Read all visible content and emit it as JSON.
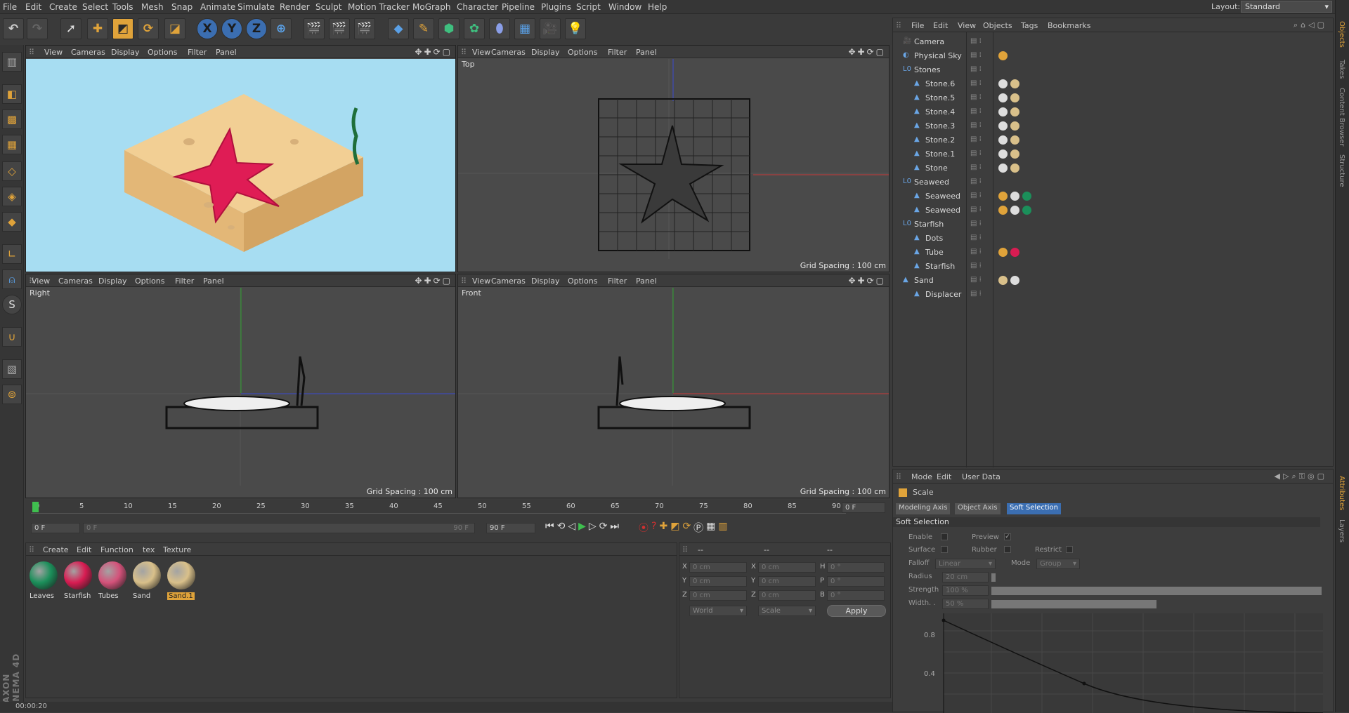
{
  "menu": [
    "File",
    "Edit",
    "Create",
    "Select",
    "Tools",
    "Mesh",
    "Snap",
    "Animate",
    "Simulate",
    "Render",
    "Sculpt",
    "Motion Tracker",
    "MoGraph",
    "Character",
    "Pipeline",
    "Plugins",
    "Script",
    "Window",
    "Help"
  ],
  "layout": {
    "label": "Layout:",
    "value": "Standard"
  },
  "viewport_menu": [
    "View",
    "Cameras",
    "Display",
    "Options",
    "Filter",
    "Panel"
  ],
  "viewports": {
    "top": {
      "label": "Top",
      "grid": "Grid Spacing : 100 cm"
    },
    "right": {
      "label": "Right",
      "grid": "Grid Spacing : 100 cm"
    },
    "front": {
      "label": "Front",
      "grid": "Grid Spacing : 100 cm"
    }
  },
  "object_manager": {
    "menu": [
      "File",
      "Edit",
      "View",
      "Objects",
      "Tags",
      "Bookmarks"
    ],
    "objects": [
      {
        "name": "Camera",
        "indent": 0
      },
      {
        "name": "Physical Sky",
        "indent": 0
      },
      {
        "name": "Stones",
        "indent": 0
      },
      {
        "name": "Stone.6",
        "indent": 1
      },
      {
        "name": "Stone.5",
        "indent": 1
      },
      {
        "name": "Stone.4",
        "indent": 1
      },
      {
        "name": "Stone.3",
        "indent": 1
      },
      {
        "name": "Stone.2",
        "indent": 1
      },
      {
        "name": "Stone.1",
        "indent": 1
      },
      {
        "name": "Stone",
        "indent": 1
      },
      {
        "name": "Seaweed",
        "indent": 0
      },
      {
        "name": "Seaweed",
        "indent": 1
      },
      {
        "name": "Seaweed",
        "indent": 1
      },
      {
        "name": "Starfish",
        "indent": 0
      },
      {
        "name": "Dots",
        "indent": 1
      },
      {
        "name": "Tube",
        "indent": 1
      },
      {
        "name": "Starfish",
        "indent": 1
      },
      {
        "name": "Sand",
        "indent": 0
      },
      {
        "name": "Displacer",
        "indent": 1
      }
    ]
  },
  "attributes": {
    "menu": [
      "Mode",
      "Edit",
      "User Data"
    ],
    "title": "Scale",
    "tabs": [
      "Modeling Axis",
      "Object Axis",
      "Soft Selection"
    ],
    "section": "Soft Selection",
    "enable": "Enable",
    "preview": "Preview",
    "surface": "Surface",
    "rubber": "Rubber",
    "restrict": "Restrict",
    "falloff_label": "Falloff",
    "falloff_value": "Linear",
    "mode_label": "Mode",
    "mode_value": "Group",
    "radius_label": "Radius",
    "radius_value": "20 cm",
    "strength_label": "Strength",
    "strength_value": "100 %",
    "width_label": "Width. .",
    "width_value": "50 %",
    "graph_y": [
      "0.8",
      "0.4"
    ]
  },
  "timeline": {
    "ticks": [
      "0",
      "5",
      "10",
      "15",
      "20",
      "25",
      "30",
      "35",
      "40",
      "45",
      "50",
      "55",
      "60",
      "65",
      "70",
      "75",
      "80",
      "85",
      "90"
    ],
    "current": "0 F",
    "start": "0 F",
    "slider_left": "0 F",
    "slider_right": "90 F",
    "end": "90 F"
  },
  "materials": {
    "menu": [
      "Create",
      "Edit",
      "Function",
      "tex",
      "Texture"
    ],
    "items": [
      {
        "name": "Leaves",
        "color": "#1b8f5a"
      },
      {
        "name": "Starfish",
        "color": "#d81c52"
      },
      {
        "name": "Tubes",
        "color": "#d4527a"
      },
      {
        "name": "Sand",
        "color": "#d9c08a"
      },
      {
        "name": "Sand.1",
        "color": "#d9c08a"
      }
    ]
  },
  "coords": {
    "header": [
      "--",
      "--",
      "--"
    ],
    "rows": [
      [
        "X",
        "0 cm",
        "X",
        "0 cm",
        "H",
        "0 °"
      ],
      [
        "Y",
        "0 cm",
        "Y",
        "0 cm",
        "P",
        "0 °"
      ],
      [
        "Z",
        "0 cm",
        "Z",
        "0 cm",
        "B",
        "0 °"
      ]
    ],
    "world": "World",
    "scale": "Scale",
    "apply": "Apply"
  },
  "status": "00:00:20",
  "brand": "MAXON CINEMA 4D",
  "right_tabs": [
    "Objects",
    "Takes",
    "Content Browser",
    "Structure",
    "Attributes",
    "Layers"
  ]
}
